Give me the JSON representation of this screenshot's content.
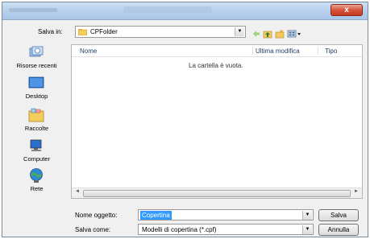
{
  "dialog": {
    "close_label": "x"
  },
  "toolbar": {
    "save_in_label": "Salva in:",
    "location_value": "CPFolder"
  },
  "places": [
    {
      "label": "Risorse recenti",
      "icon": "recent-places-icon"
    },
    {
      "label": "Desktop",
      "icon": "desktop-icon"
    },
    {
      "label": "Raccolte",
      "icon": "libraries-icon"
    },
    {
      "label": "Computer",
      "icon": "computer-icon"
    },
    {
      "label": "Rete",
      "icon": "network-icon"
    }
  ],
  "filelist": {
    "columns": [
      "Nome",
      "Ultima modifica",
      "Tipo"
    ],
    "empty_message": "La cartella è vuota."
  },
  "form": {
    "filename_label": "Nome oggetto:",
    "filename_value": "Copertina",
    "savetype_label": "Salva come:",
    "savetype_value": "Modelli di copertina (*.cpf)",
    "save_button": "Salva",
    "cancel_button": "Annulla"
  },
  "colors": {
    "titlebar": "#b8d1ec",
    "close": "#c6381b",
    "selection": "#3399ff"
  }
}
